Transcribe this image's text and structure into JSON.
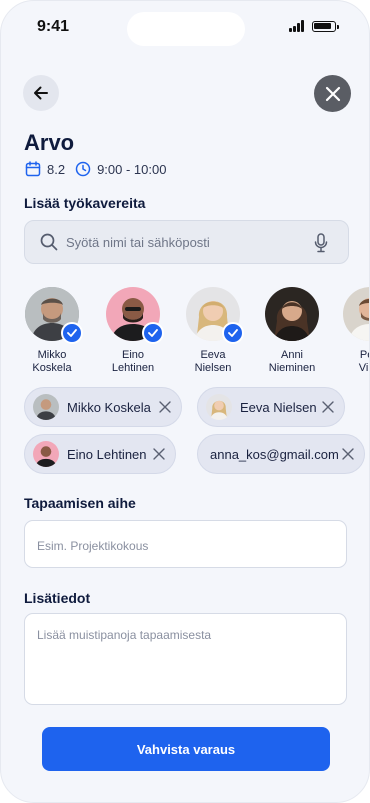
{
  "status_bar": {
    "time": "9:41"
  },
  "header": {
    "title": "Arvo",
    "date": "8.2",
    "time_range": "9:00 - 10:00"
  },
  "coworkers": {
    "label": "Lisää työkavereita",
    "search_placeholder": "Syötä nimi tai sähköposti",
    "people": [
      {
        "first": "Mikko",
        "last": "Koskela",
        "selected": true
      },
      {
        "first": "Eino",
        "last": "Lehtinen",
        "selected": true
      },
      {
        "first": "Eeva",
        "last": "Nielsen",
        "selected": true
      },
      {
        "first": "Anni",
        "last": "Nieminen",
        "selected": false
      },
      {
        "first": "Petr",
        "last": "Virta",
        "selected": false
      }
    ],
    "chips": [
      {
        "label": "Mikko Koskela"
      },
      {
        "label": "Eeva Nielsen"
      },
      {
        "label": "Eino Lehtinen"
      },
      {
        "label": "anna_kos@gmail.com"
      }
    ]
  },
  "topic": {
    "label": "Tapaamisen aihe",
    "placeholder": "Esim. Projektikokous"
  },
  "notes": {
    "label": "Lisätiedot",
    "placeholder": "Lisää muistipanoja tapaamisesta"
  },
  "confirm_label": "Vahvista varaus",
  "colors": {
    "accent": "#1e63ee",
    "background": "#f4f6fb",
    "text": "#0f1b3d"
  }
}
